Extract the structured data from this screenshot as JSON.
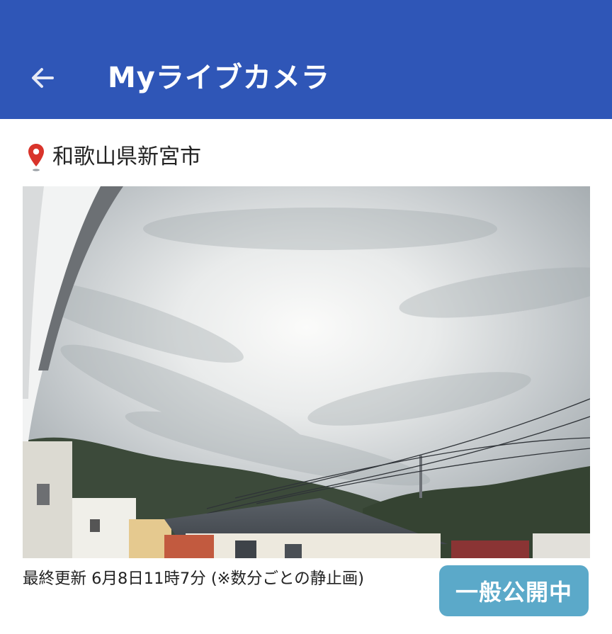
{
  "header": {
    "title": "Myライブカメラ",
    "back_icon": "arrow-left-icon",
    "background_color": "#2f56b7"
  },
  "location": {
    "icon": "map-pin-icon",
    "icon_color": "#d9342b",
    "name": "和歌山県新宮市"
  },
  "camera": {
    "description_icon": "camera-still-image"
  },
  "footer": {
    "last_updated": "最終更新 6月8日11時7分 (※数分ごとの静止画)",
    "public_status": "一般公開中",
    "badge_color": "#5ba9c9"
  }
}
